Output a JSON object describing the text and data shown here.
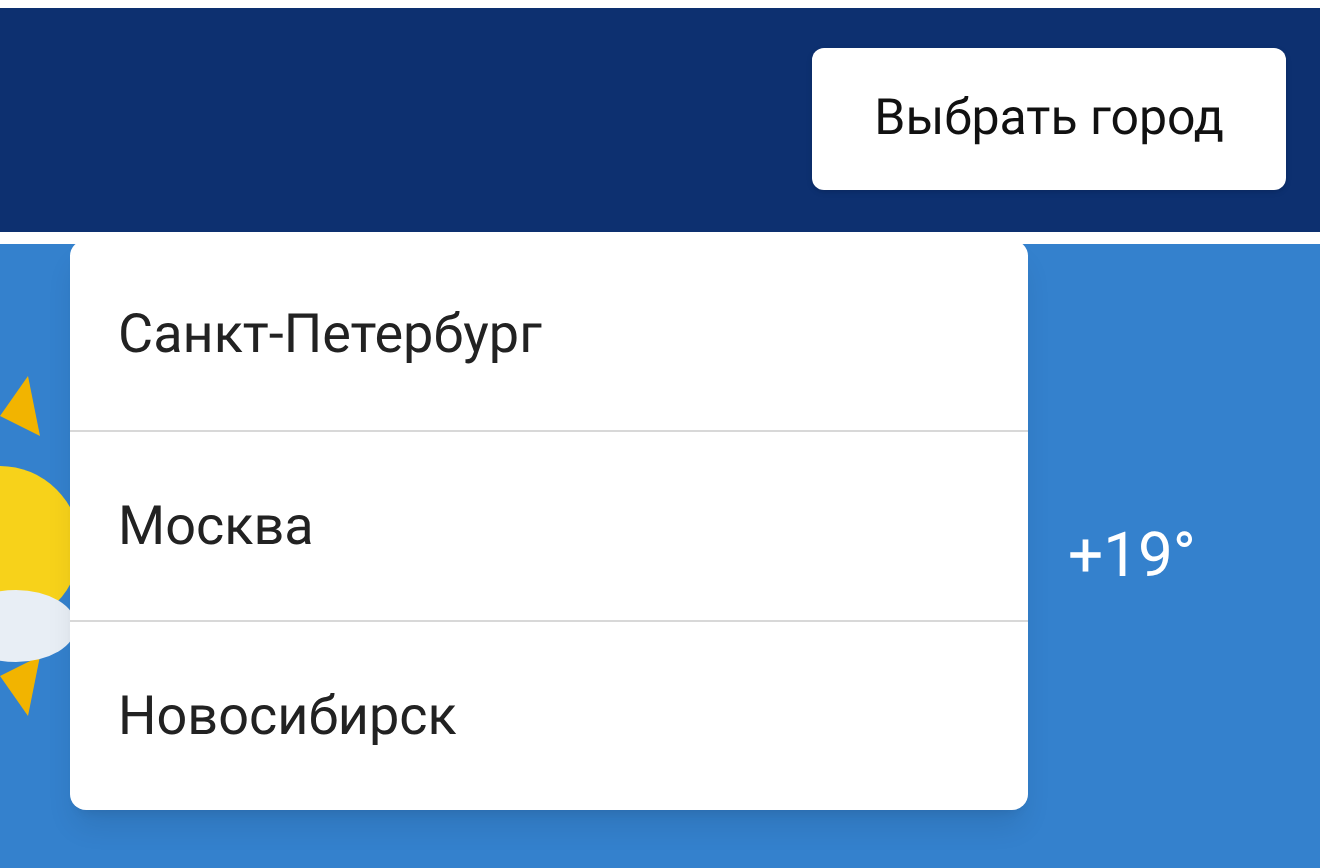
{
  "header": {
    "city_button": "Выбрать город"
  },
  "weather": {
    "temperature": "+19°"
  },
  "city_menu": {
    "items": [
      {
        "label": "Санкт-Петербург"
      },
      {
        "label": "Москва"
      },
      {
        "label": "Новосибирск"
      }
    ]
  }
}
